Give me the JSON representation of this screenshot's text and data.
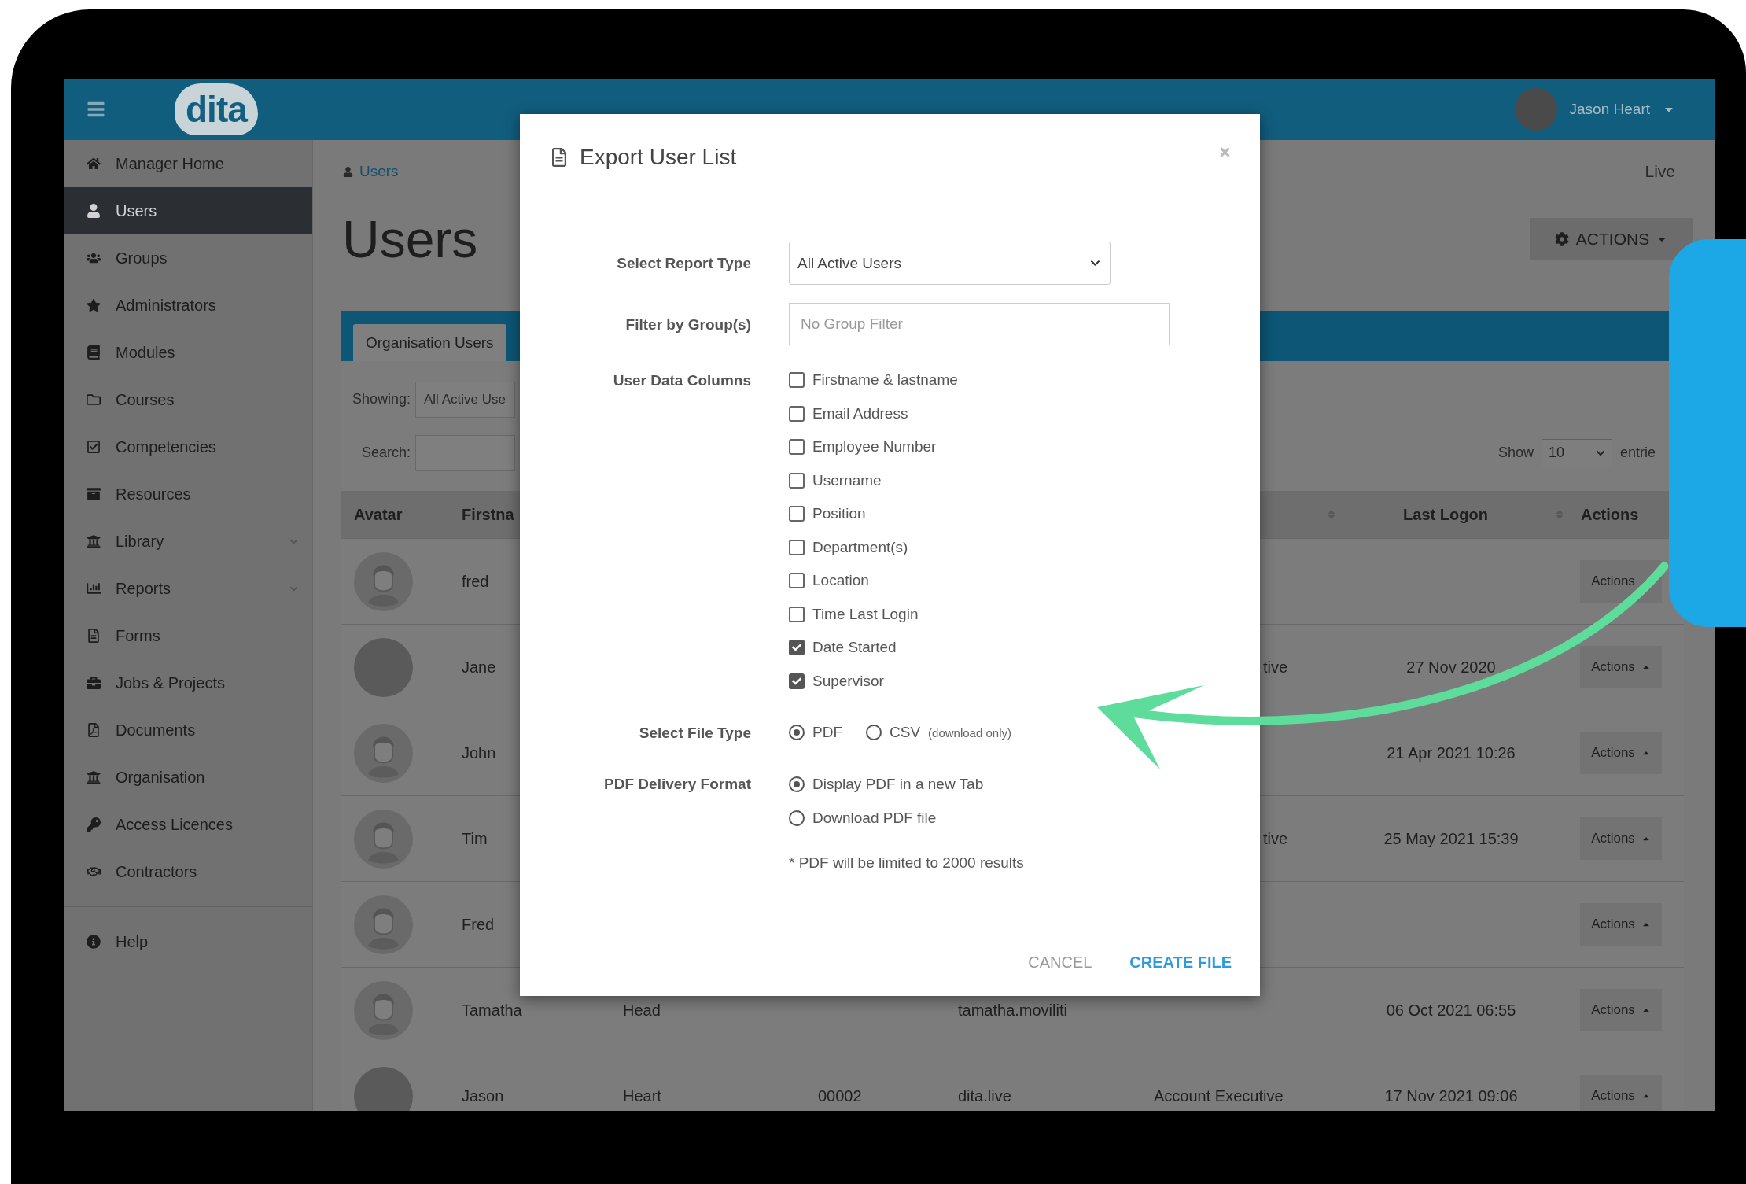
{
  "header": {
    "logo": "dita",
    "user_name": "Jason Heart"
  },
  "sidebar": {
    "items": [
      {
        "label": "Manager Home",
        "selected": false,
        "submenu": false
      },
      {
        "label": "Users",
        "selected": true,
        "submenu": false
      },
      {
        "label": "Groups",
        "selected": false,
        "submenu": false
      },
      {
        "label": "Administrators",
        "selected": false,
        "submenu": false
      },
      {
        "label": "Modules",
        "selected": false,
        "submenu": false
      },
      {
        "label": "Courses",
        "selected": false,
        "submenu": false
      },
      {
        "label": "Competencies",
        "selected": false,
        "submenu": false
      },
      {
        "label": "Resources",
        "selected": false,
        "submenu": false
      },
      {
        "label": "Library",
        "selected": false,
        "submenu": true
      },
      {
        "label": "Reports",
        "selected": false,
        "submenu": true
      },
      {
        "label": "Forms",
        "selected": false,
        "submenu": false
      },
      {
        "label": "Jobs & Projects",
        "selected": false,
        "submenu": false
      },
      {
        "label": "Documents",
        "selected": false,
        "submenu": false
      },
      {
        "label": "Organisation",
        "selected": false,
        "submenu": false
      },
      {
        "label": "Access Licences",
        "selected": false,
        "submenu": false
      },
      {
        "label": "Contractors",
        "selected": false,
        "submenu": false
      }
    ],
    "footer_items": [
      {
        "label": "Help",
        "selected": false,
        "submenu": false
      }
    ]
  },
  "breadcrumb": "Users",
  "environment": "Live",
  "page_title": "Users",
  "actions_button": "ACTIONS",
  "panel": {
    "tabs": [
      {
        "label": "Organisation Users",
        "selected": true
      }
    ],
    "showing_label": "Showing:",
    "showing_value": "All Active Use",
    "search_label": "Search:",
    "show_label": "Show",
    "page_size": "10",
    "entries_label": "entrie"
  },
  "table": {
    "columns": {
      "avatar": "Avatar",
      "firstname": "Firstna",
      "position_sortable": true,
      "last_logon": "Last Logon",
      "last_logon_sortable": true,
      "actions": "Actions"
    },
    "rows": [
      {
        "kind": "default",
        "firstname": "fred",
        "action": "Actions"
      },
      {
        "kind": "photo",
        "firstname": "Jane",
        "position": "tive",
        "position_clipped": true,
        "last_logon": "27 Nov 2020",
        "action": "Actions"
      },
      {
        "kind": "default",
        "firstname": "John",
        "last_logon": "21 Apr 2021 10:26",
        "action": "Actions"
      },
      {
        "kind": "default",
        "firstname": "Tim",
        "position": "tive",
        "position_clipped": true,
        "last_logon": "25 May 2021 15:39",
        "action": "Actions"
      },
      {
        "kind": "default",
        "firstname": "Fred",
        "action": "Actions"
      },
      {
        "kind": "default",
        "firstname": "Tamatha",
        "lastname": "Head",
        "username": "tamatha.moviliti",
        "last_logon": "06 Oct 2021 06:55",
        "action": "Actions"
      },
      {
        "kind": "photo",
        "firstname": "Jason",
        "lastname": "Heart",
        "employee_number": "00002",
        "username": "dita.live",
        "position": "Account Executive",
        "position_clipped": false,
        "last_logon": "17 Nov 2021 09:06",
        "action": "Actions"
      }
    ]
  },
  "dialog": {
    "title": "Export User List",
    "report_type": {
      "label": "Select Report Type",
      "value": "All Active Users"
    },
    "group_filter": {
      "label": "Filter by Group(s)",
      "placeholder": "No Group Filter"
    },
    "columns": {
      "label": "User Data Columns",
      "options": [
        {
          "label": "Firstname & lastname",
          "checked": false
        },
        {
          "label": "Email Address",
          "checked": false
        },
        {
          "label": "Employee Number",
          "checked": false
        },
        {
          "label": "Username",
          "checked": false
        },
        {
          "label": "Position",
          "checked": false
        },
        {
          "label": "Department(s)",
          "checked": false
        },
        {
          "label": "Location",
          "checked": false
        },
        {
          "label": "Time Last Login",
          "checked": false
        },
        {
          "label": "Date Started",
          "checked": true
        },
        {
          "label": "Supervisor",
          "checked": true
        }
      ]
    },
    "file_type": {
      "label": "Select File Type",
      "options": [
        {
          "label": "PDF",
          "selected": true
        },
        {
          "label": "CSV",
          "note": "(download only)",
          "selected": false
        }
      ]
    },
    "delivery": {
      "label": "PDF Delivery Format",
      "options": [
        {
          "label": "Display PDF in a new Tab",
          "selected": true
        },
        {
          "label": "Download PDF file",
          "selected": false
        }
      ]
    },
    "note": "* PDF will be limited to 2000 results",
    "buttons": [
      {
        "label": "CANCEL",
        "kind": "secondary"
      },
      {
        "label": "CREATE FILE",
        "kind": "primary"
      }
    ]
  }
}
